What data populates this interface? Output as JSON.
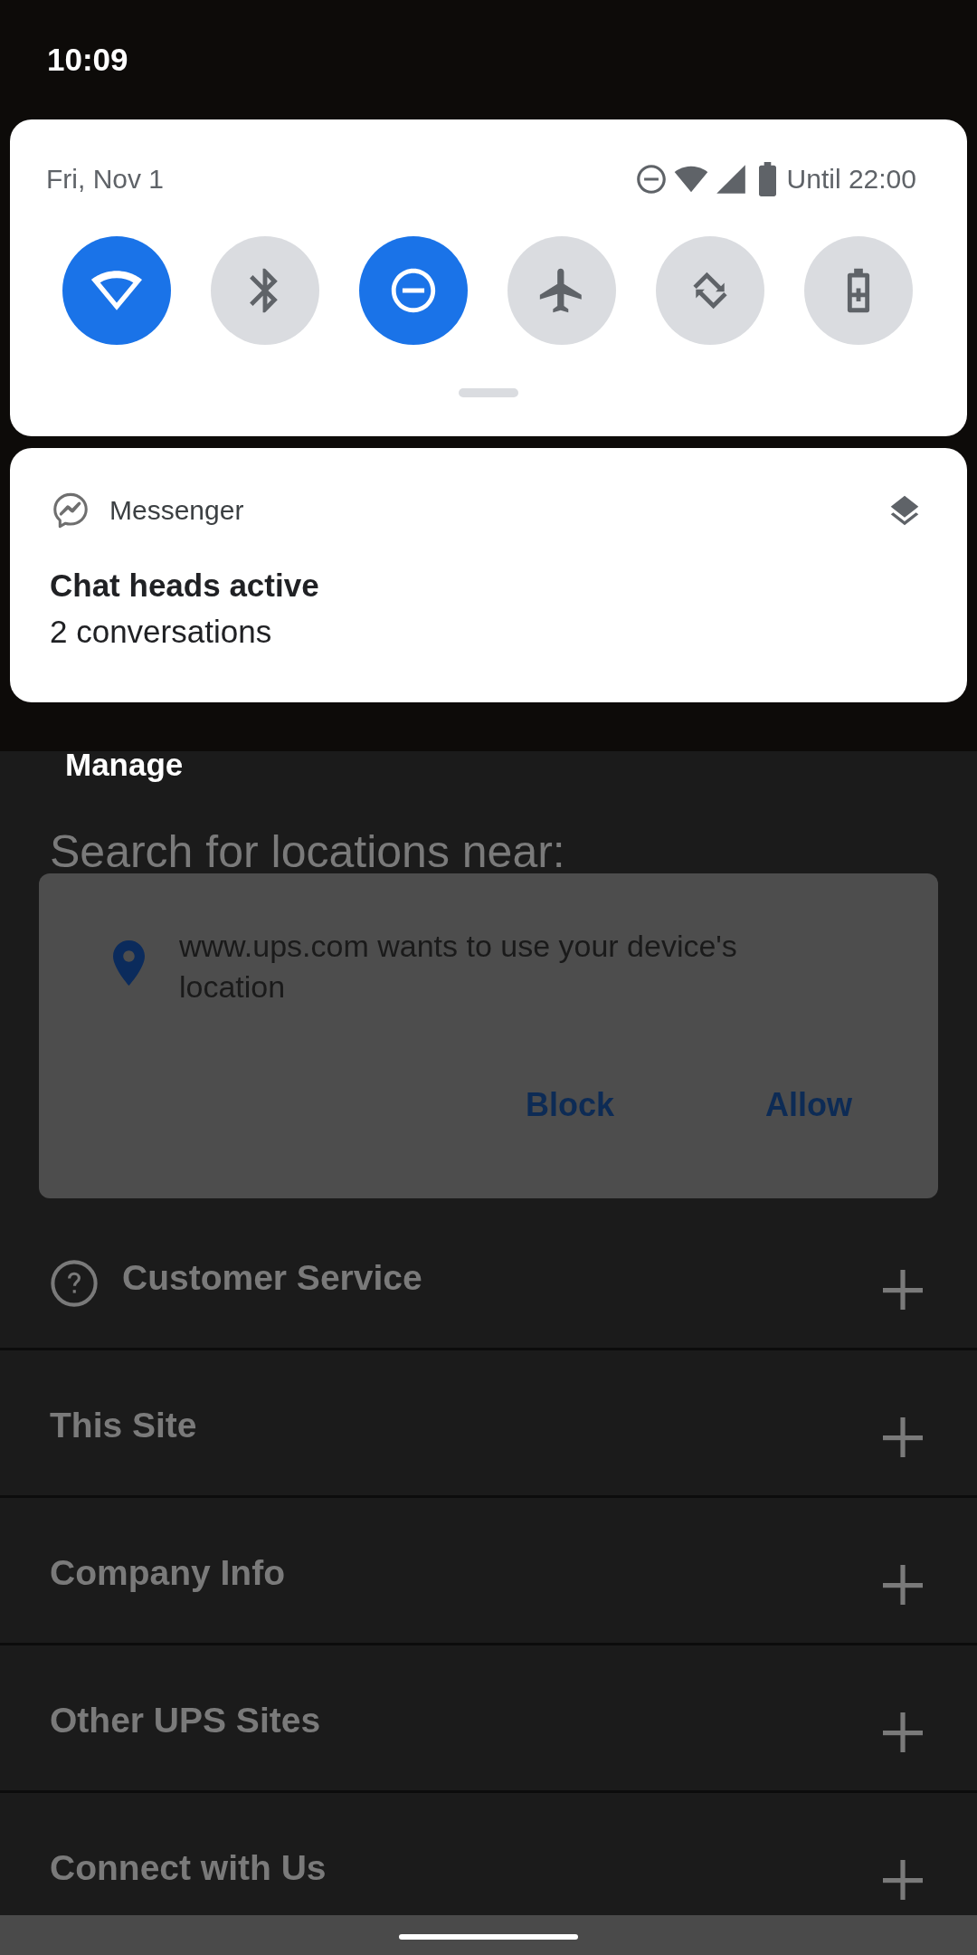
{
  "status_bar": {
    "time": "10:09"
  },
  "quick_settings": {
    "date": "Fri, Nov 1",
    "battery_text": "Until 22:00",
    "tiles": [
      {
        "kind": "wifi",
        "on": true
      },
      {
        "kind": "bluetooth",
        "on": false
      },
      {
        "kind": "do_not_disturb",
        "on": true
      },
      {
        "kind": "airplane",
        "on": false
      },
      {
        "kind": "auto_rotate",
        "on": false
      },
      {
        "kind": "battery_saver",
        "on": false
      }
    ]
  },
  "notification": {
    "app": "Messenger",
    "title": "Chat heads active",
    "text": "2 conversations"
  },
  "manage_label": "Manage",
  "page": {
    "heading": "Search for locations near:",
    "permission_dialog": {
      "message": "www.ups.com wants to use your device's location",
      "buttons": [
        "Block",
        "Allow"
      ]
    },
    "footer_sections": [
      {
        "label": "Customer Service",
        "kind": "help",
        "expanded": false
      },
      {
        "label": "This Site",
        "kind": "plain",
        "expanded": false
      },
      {
        "label": "Company Info",
        "kind": "plain",
        "expanded": false
      },
      {
        "label": "Other UPS Sites",
        "kind": "plain",
        "expanded": false
      },
      {
        "label": "Connect with Us",
        "kind": "plain",
        "expanded": false
      }
    ]
  }
}
